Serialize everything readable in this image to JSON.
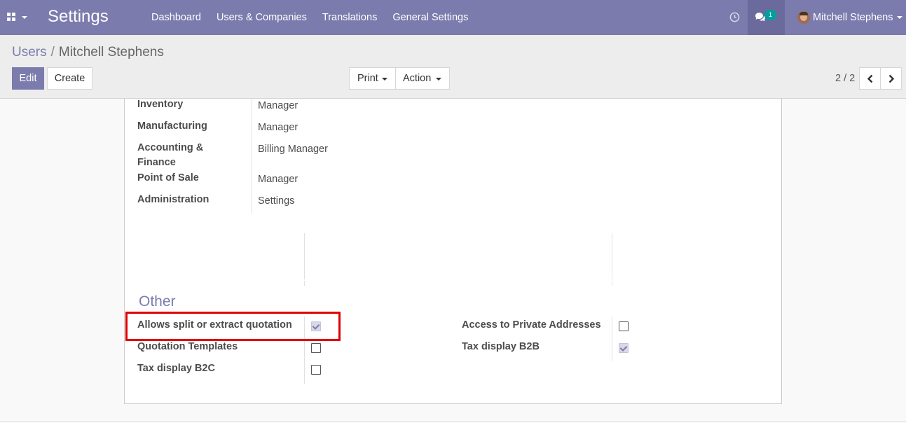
{
  "navbar": {
    "app_title": "Settings",
    "menu": [
      "Dashboard",
      "Users & Companies",
      "Translations",
      "General Settings"
    ],
    "chat_badge": "1",
    "user_name": "Mitchell Stephens",
    "accent_color": "#7c7bad"
  },
  "breadcrumb": {
    "parent": "Users",
    "separator": "/",
    "current": "Mitchell Stephens"
  },
  "toolbar": {
    "edit_label": "Edit",
    "create_label": "Create",
    "print_label": "Print",
    "action_label": "Action"
  },
  "pager": {
    "value": "2 / 2"
  },
  "access_rights": [
    {
      "label": "Inventory",
      "value": "Manager"
    },
    {
      "label": "Manufacturing",
      "value": "Manager"
    },
    {
      "label": "Accounting &",
      "label2": "Finance",
      "value": "Billing Manager"
    },
    {
      "label": "Point of Sale",
      "value": "Manager"
    },
    {
      "label": "Administration",
      "value": "Settings"
    }
  ],
  "other": {
    "title": "Other",
    "left": [
      {
        "label": "Allows split or extract quotation",
        "checked": true
      },
      {
        "label": "Quotation Templates",
        "checked": false
      },
      {
        "label": "Tax display B2C",
        "checked": false
      }
    ],
    "right": [
      {
        "label": "Access to Private Addresses",
        "checked": false
      },
      {
        "label": "Tax display B2B",
        "checked": true
      }
    ]
  },
  "icons": {
    "apps": "grid-icon",
    "clock": "clock-icon",
    "chat": "chat-icon",
    "prev": "chevron-left-icon",
    "next": "chevron-right-icon"
  },
  "highlight_color": "#e00000"
}
